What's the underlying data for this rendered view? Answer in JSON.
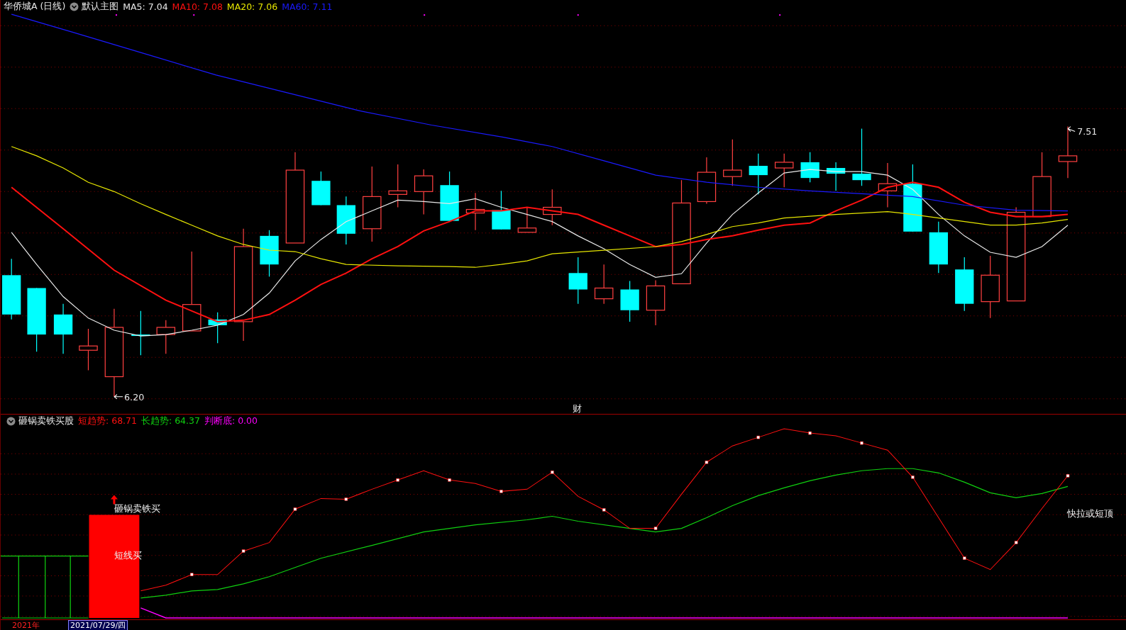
{
  "main_chart": {
    "title": "华侨城A (日线)",
    "template": "默认主图",
    "ma_readings": [
      {
        "label": "MA5: 7.04",
        "color": "#e8e8e8"
      },
      {
        "label": "MA10: 7.08",
        "color": "#ff1010"
      },
      {
        "label": "MA20: 7.06",
        "color": "#e6e600"
      },
      {
        "label": "MA60: 7.11",
        "color": "#1a1aff"
      }
    ],
    "high_label": "7.51",
    "low_label": "6.20",
    "marker": "财"
  },
  "indicator": {
    "title": "砸锅卖铁买股",
    "readings": [
      {
        "label": "短趋势: 68.71",
        "color": "#ff1010"
      },
      {
        "label": "长趋势: 64.37",
        "color": "#10d010"
      },
      {
        "label": "判断底: 0.00",
        "color": "#ff00ff"
      }
    ],
    "signals": [
      "砸锅卖铁买",
      "短线买",
      "快拉或短顶"
    ]
  },
  "time_axis": {
    "labels": [
      {
        "text": "2021年",
        "selected": false
      },
      {
        "text": "2021/07/29/四",
        "selected": true
      }
    ]
  }
}
